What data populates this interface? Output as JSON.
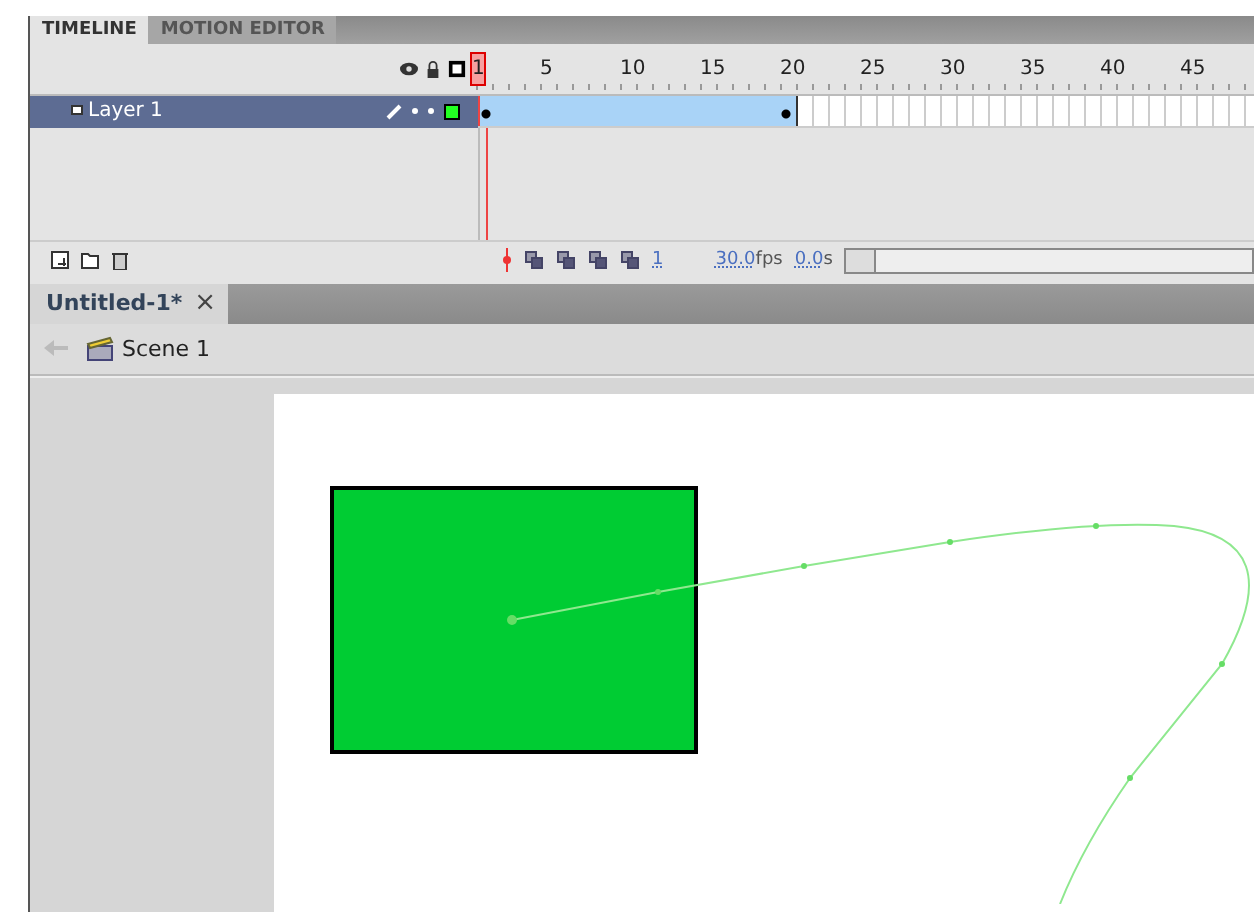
{
  "panel_tabs": [
    {
      "label": "TIMELINE",
      "selected": true
    },
    {
      "label": "MOTION EDITOR",
      "selected": false
    }
  ],
  "ruler_labels": [
    "1",
    "5",
    "10",
    "15",
    "20",
    "25",
    "30",
    "35",
    "40",
    "45"
  ],
  "layers": [
    {
      "name": "Layer 1",
      "selected": true,
      "tween": {
        "level": 0.41
      }
    }
  ],
  "status": {
    "current_frame": "1",
    "frame_rate": "30.0",
    "fps_unit": "fps",
    "elapsed": "0.0",
    "elapsed_unit": "s"
  },
  "document_tabs": [
    {
      "label": "Untitled-1*",
      "close": "×",
      "selected": true
    }
  ],
  "breadcrumb": {
    "scene": "Scene 1"
  }
}
